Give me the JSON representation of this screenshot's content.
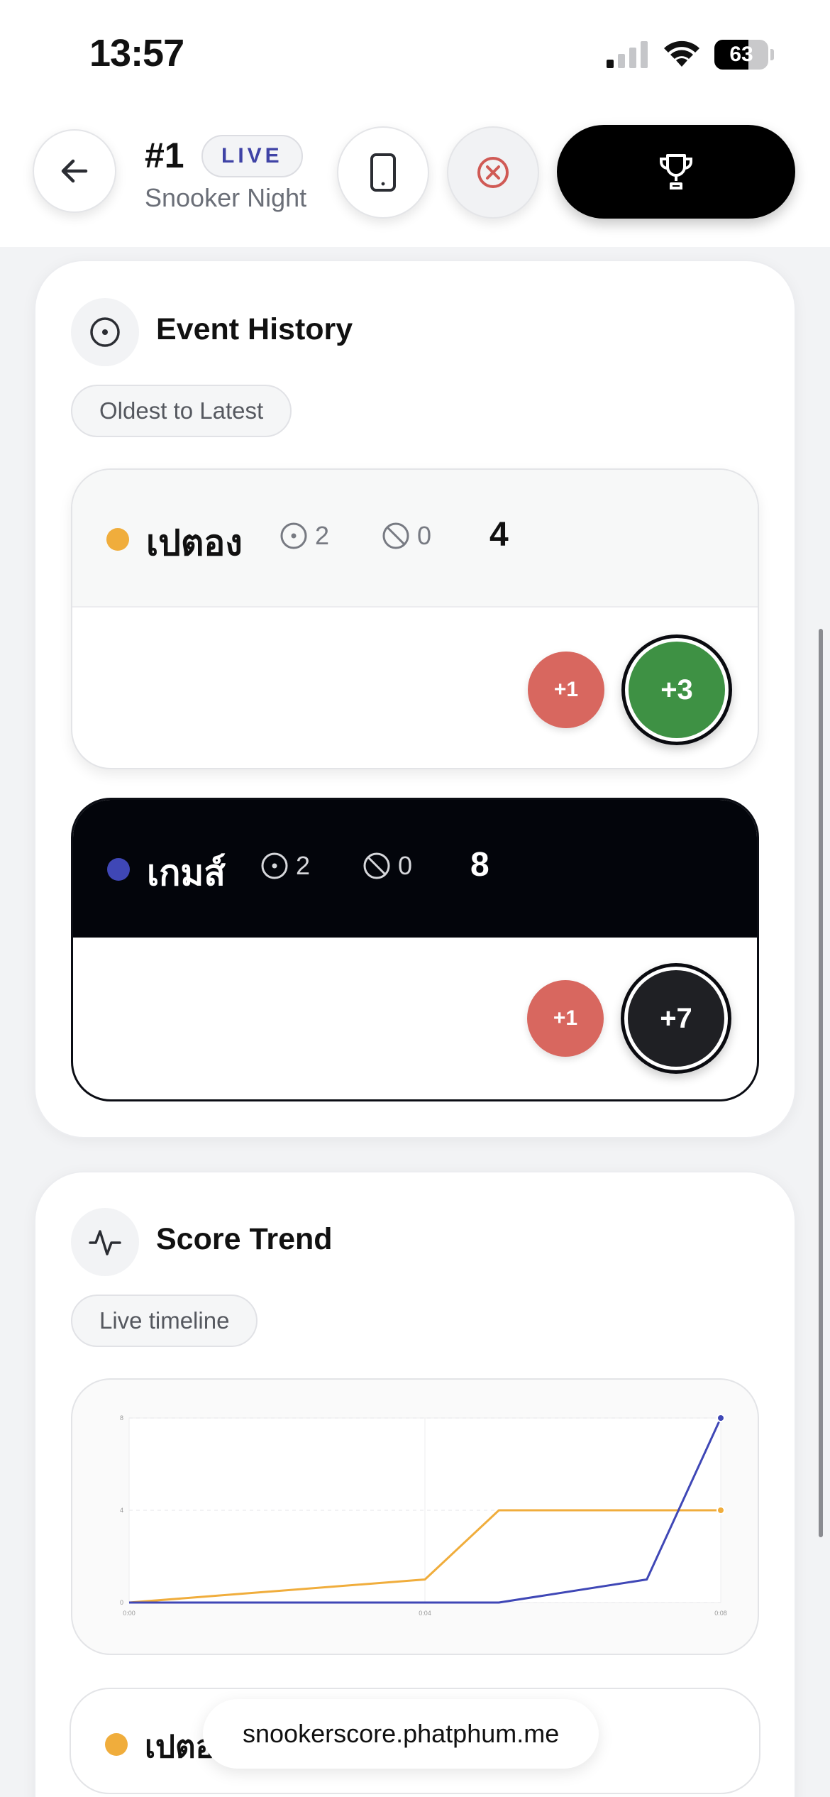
{
  "status_bar": {
    "time": "13:57",
    "battery_level": "63",
    "battery_percent": 63,
    "signal_bars_active": 1,
    "icons": [
      "cellular-signal-icon",
      "wifi-icon",
      "battery-icon"
    ]
  },
  "header": {
    "match_number": "#1",
    "live_badge": "LIVE",
    "match_name": "Snooker Night",
    "buttons": [
      "back-arrow-icon",
      "phone-device-icon",
      "close-circle-icon",
      "trophy-icon"
    ]
  },
  "event_history": {
    "title": "Event History",
    "sort_label": "Oldest to Latest",
    "icon": "target-icon",
    "players": [
      {
        "name": "เปตอง",
        "color": "#f0ad3c",
        "pots": "2",
        "fouls": "0",
        "score": "4",
        "events": [
          {
            "label": "+1",
            "color": "#d8675f"
          },
          {
            "label": "+3",
            "color": "#3e9144"
          }
        ]
      },
      {
        "name": "เกมส์",
        "color": "#3f47b6",
        "pots": "2",
        "fouls": "0",
        "score": "8",
        "events": [
          {
            "label": "+1",
            "color": "#d8675f"
          },
          {
            "label": "+7",
            "color": "#1f2024"
          }
        ]
      }
    ]
  },
  "score_trend": {
    "title": "Score Trend",
    "subtitle": "Live timeline",
    "icon": "activity-pulse-icon"
  },
  "chart_data": {
    "type": "line",
    "title": "",
    "xlabel": "",
    "ylabel": "",
    "x_ticks": [
      "0:00",
      "0:04",
      "0:08"
    ],
    "y_ticks": [
      "0",
      "4",
      "8"
    ],
    "ylim": [
      0,
      8
    ],
    "grid": true,
    "series": [
      {
        "name": "เปตอง",
        "color": "#f0ad3c",
        "points": [
          [
            0,
            0
          ],
          [
            4,
            1
          ],
          [
            5,
            4
          ],
          [
            8,
            4
          ]
        ]
      },
      {
        "name": "เกมส์",
        "color": "#3f47b6",
        "points": [
          [
            0,
            0
          ],
          [
            5,
            0
          ],
          [
            7,
            1
          ],
          [
            8,
            8
          ]
        ]
      }
    ]
  },
  "legend_partial": {
    "name": "เปตอ",
    "color": "#f0ad3c"
  },
  "browser": {
    "url": "snookerscore.phatphum.me"
  }
}
